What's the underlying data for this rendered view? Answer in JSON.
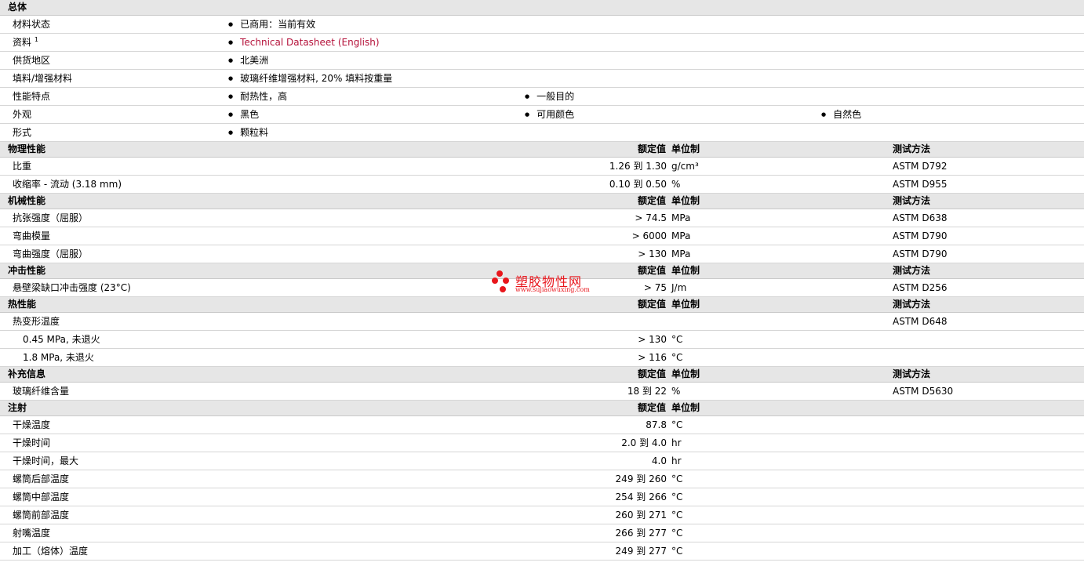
{
  "general": {
    "title": "总体",
    "rows": [
      {
        "label": "材料状态",
        "items": [
          "已商用：当前有效"
        ]
      },
      {
        "label": "资料",
        "sup": "1",
        "items": [
          "Technical Datasheet (English)"
        ]
      },
      {
        "label": "供货地区",
        "items": [
          "北美洲"
        ]
      },
      {
        "label": "填料/增强材料",
        "items": [
          "玻璃纤维增强材料, 20% 填料按重量"
        ]
      },
      {
        "label": "性能特点",
        "items": [
          "耐热性，高",
          "一般目的"
        ]
      },
      {
        "label": "外观",
        "items": [
          "黑色",
          "可用颜色",
          "自然色"
        ]
      },
      {
        "label": "形式",
        "items": [
          "颗粒料"
        ]
      }
    ]
  },
  "headers": {
    "value": "额定值",
    "unit": "单位制",
    "test": "测试方法"
  },
  "physical": {
    "title": "物理性能",
    "rows": [
      {
        "label": "比重",
        "value": "1.26 到  1.30",
        "unit": "g/cm³",
        "test": "ASTM D792"
      },
      {
        "label": "收缩率  - 流动  (3.18 mm)",
        "value": "0.10 到  0.50",
        "unit": "%",
        "test": "ASTM D955"
      }
    ]
  },
  "mechanical": {
    "title": "机械性能",
    "rows": [
      {
        "label": "抗张强度（屈服）",
        "value": "> 74.5",
        "unit": "MPa",
        "test": "ASTM D638"
      },
      {
        "label": "弯曲模量",
        "value": "> 6000",
        "unit": "MPa",
        "test": "ASTM D790"
      },
      {
        "label": "弯曲强度（屈服）",
        "value": "> 130",
        "unit": "MPa",
        "test": "ASTM D790"
      }
    ]
  },
  "impact": {
    "title": "冲击性能",
    "rows": [
      {
        "label": "悬壁梁缺口冲击强度  (23°C)",
        "value": "> 75",
        "unit": "J/m",
        "test": "ASTM D256"
      }
    ]
  },
  "thermal": {
    "title": "热性能",
    "rows": [
      {
        "label": "热变形温度",
        "value": "",
        "unit": "",
        "test": "ASTM D648"
      },
      {
        "label": "0.45 MPa, 未退火",
        "value": "> 130",
        "unit": "°C",
        "test": ""
      },
      {
        "label": "1.8 MPa, 未退火",
        "value": "> 116",
        "unit": "°C",
        "test": ""
      }
    ]
  },
  "supplemental": {
    "title": "补充信息",
    "rows": [
      {
        "label": "玻璃纤维含量",
        "value": "18 到  22",
        "unit": "%",
        "test": "ASTM D5630"
      }
    ]
  },
  "injection": {
    "title": "注射",
    "rows": [
      {
        "label": "干燥温度",
        "value": "87.8",
        "unit": "°C"
      },
      {
        "label": "干燥时间",
        "value": "2.0 到  4.0",
        "unit": "hr"
      },
      {
        "label": "干燥时间，最大",
        "value": "4.0",
        "unit": "hr"
      },
      {
        "label": "螺筒后部温度",
        "value": "249 到  260",
        "unit": "°C"
      },
      {
        "label": "螺筒中部温度",
        "value": "254 到  266",
        "unit": "°C"
      },
      {
        "label": "螺筒前部温度",
        "value": "260 到  271",
        "unit": "°C"
      },
      {
        "label": "射嘴温度",
        "value": "266 到  277",
        "unit": "°C"
      },
      {
        "label": "加工（熔体）温度",
        "value": "249 到  277",
        "unit": "°C"
      }
    ]
  },
  "watermark": {
    "name": "塑胶物性网",
    "url": "www.sujiaowuxing.com",
    "color": "#e8161c"
  },
  "colors": {
    "section_bg": "#e6e6e6",
    "link": "#b5133b",
    "divider": "#d6d6d6"
  }
}
